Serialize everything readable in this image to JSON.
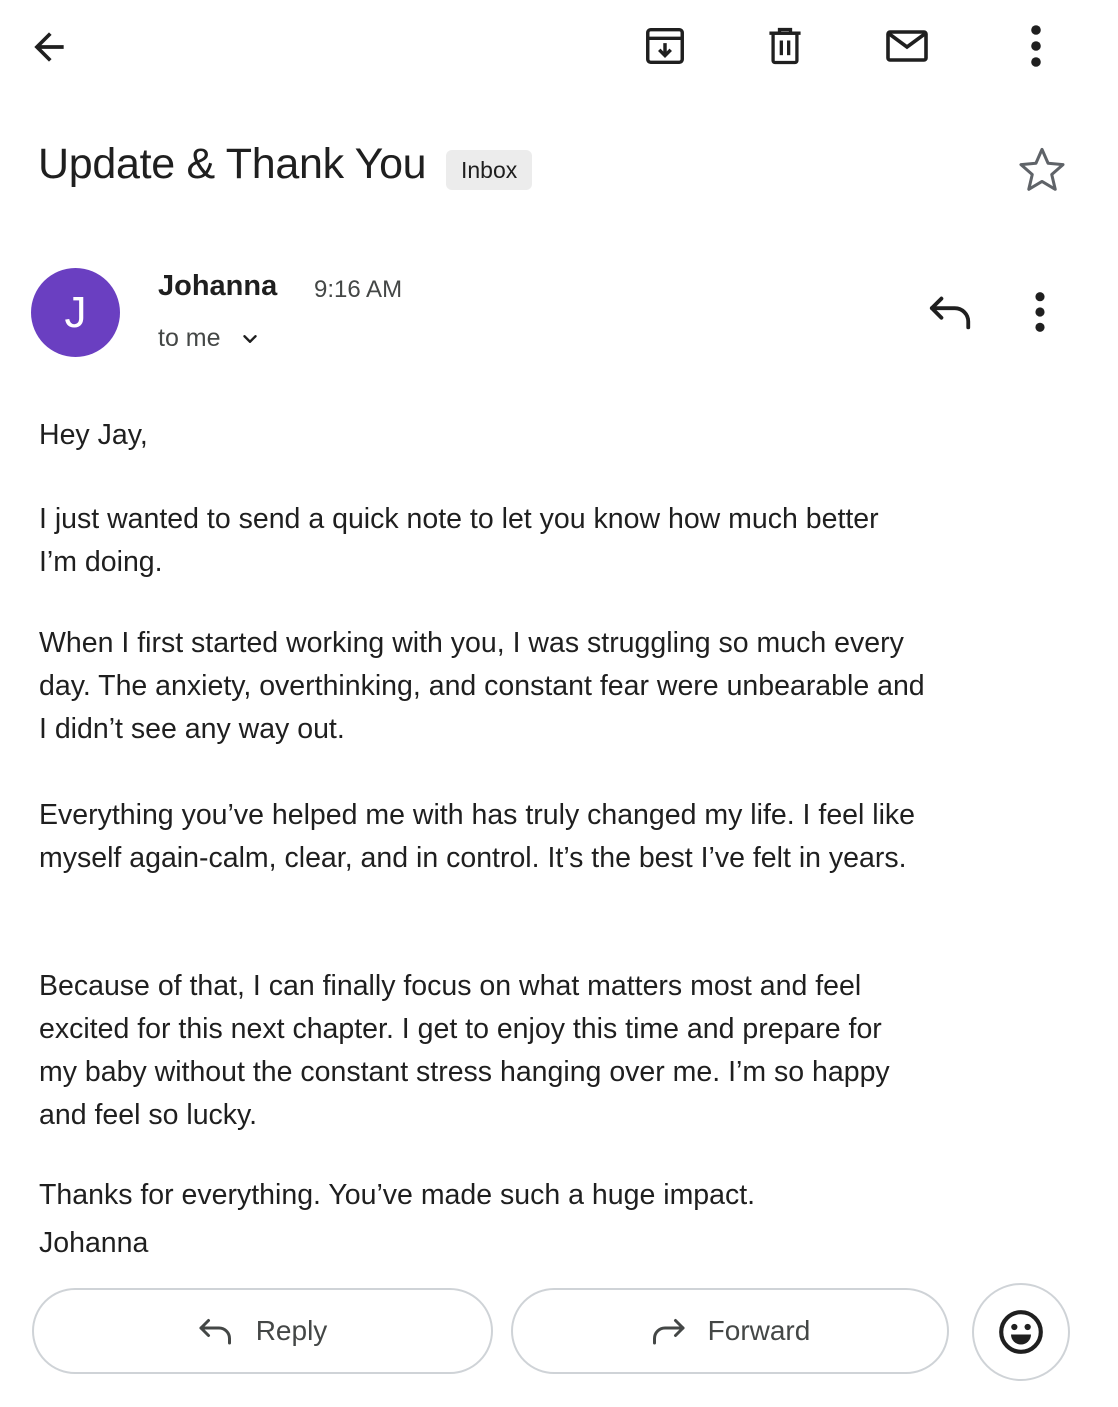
{
  "toolbar": {
    "back_icon": "arrow-back-icon",
    "archive_icon": "archive-icon",
    "delete_icon": "trash-icon",
    "mark_unread_icon": "mail-icon",
    "more_icon": "more-vert-icon"
  },
  "email": {
    "subject": "Update & Thank You",
    "label": "Inbox",
    "starred": false,
    "sender": {
      "initial": "J",
      "name": "Johanna",
      "time": "9:16 AM",
      "recipient": "to me",
      "avatar_color": "#6a3fc1"
    },
    "body": {
      "greeting": "Hey Jay,",
      "paragraph_1": "I just wanted to send a quick note to let you know how much better I’m doing.",
      "paragraph_2": "When I first started working with you, I was struggling so much every day. The anxiety, overthinking, and constant fear were unbearable and I didn’t see any way out.",
      "paragraph_3": "Everything you’ve helped me with has truly changed my life. I feel like myself again-calm, clear, and in control. It’s the best I’ve felt in years.",
      "paragraph_4": "Because of that, I can finally focus on what matters most and feel excited for this next chapter. I get to enjoy this time and prepare for my baby without the constant stress hanging over me. I’m so happy and feel so lucky.",
      "closing": "Thanks for everything. You’ve made such a huge impact.",
      "signature": "Johanna"
    }
  },
  "actions": {
    "reply_label": "Reply",
    "forward_label": "Forward",
    "emoji_icon": "emoji-reaction-icon"
  }
}
